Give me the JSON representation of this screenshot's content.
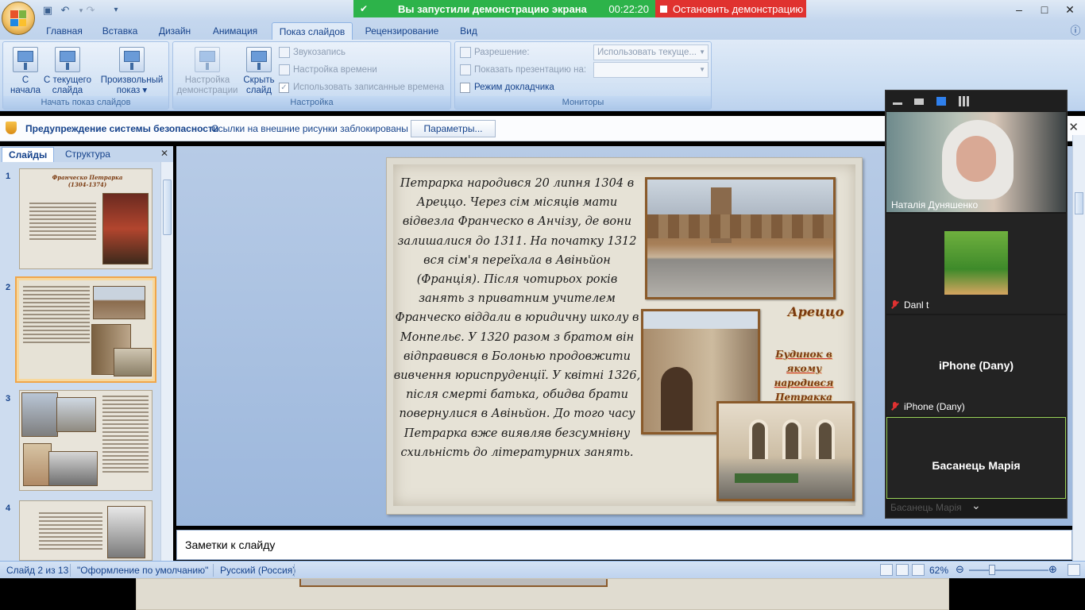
{
  "app": {
    "qat": [
      "save-icon",
      "undo-icon",
      "redo-icon",
      "qat-more-icon"
    ],
    "window_controls": [
      "–",
      "□",
      "✕"
    ]
  },
  "share_banner": {
    "message": "Вы запустили демонстрацию экрана",
    "timer": "00:22:20",
    "stop_label": "Остановить демонстрацию",
    "green": "#2db34a",
    "red": "#e0322f"
  },
  "tabs": [
    {
      "label": "Главная"
    },
    {
      "label": "Вставка"
    },
    {
      "label": "Дизайн"
    },
    {
      "label": "Анимация"
    },
    {
      "label": "Показ слайдов",
      "active": true
    },
    {
      "label": "Рецензирование"
    },
    {
      "label": "Вид"
    }
  ],
  "ribbon": {
    "start_group": {
      "label": "Начать показ слайдов",
      "from_start_l1": "С",
      "from_start_l2": "начала",
      "from_current_l1": "С текущего",
      "from_current_l2": "слайда",
      "custom_l1": "Произвольный",
      "custom_l2": "показ ▾"
    },
    "setup_group": {
      "label": "Настройка",
      "setup_show_l1": "Настройка",
      "setup_show_l2": "демонстрации",
      "hide_slide_l1": "Скрыть",
      "hide_slide_l2": "слайд",
      "record_narration": "Звукозапись",
      "rehearse_timings": "Настройка времени",
      "use_timings": "Использовать записанные времена"
    },
    "monitors_group": {
      "label": "Мониторы",
      "resolution_label": "Разрешение:",
      "resolution_value": "Использовать текуще...",
      "show_on_label": "Показать презентацию на:",
      "show_on_value": "",
      "presenter_view": "Режим докладчика"
    }
  },
  "security_bar": {
    "title": "Предупреждение системы безопасности",
    "message": "Ссылки на внешние рисунки заблокированы",
    "button": "Параметры..."
  },
  "slides_pane": {
    "tab_slides": "Слайды",
    "tab_outline": "Структура",
    "thumbs": [
      {
        "num": "1",
        "title": "Франческо Петрарка (1304-1374)"
      },
      {
        "num": "2",
        "title": "",
        "selected": true
      },
      {
        "num": "3",
        "title": ""
      },
      {
        "num": "4",
        "title": ""
      }
    ]
  },
  "slide": {
    "body": "Петрарка народився 20 липня 1304 в Ареццо. Через сім місяців мати відвезла Франческо в Анчізу, де вони залишалися до 1311. На початку 1312 вся сім'я переїхала в Авіньйон (Франція). Після чотирьох років занять з приватним учителем Франческо віддали в юридичну школу в Монпельє. У 1320 разом з братом він відправився в Болонью продовжити вивчення юриспруденції. У квітні 1326, після смерті батька, обидва брати повернулися в Авіньйон. До того часу Петрарка вже виявляв безсумнівну схильність до літературних занять.",
    "caption_arezzo": "Ареццо",
    "caption_house": "Будинок в якому народився Петракка"
  },
  "notes": {
    "placeholder": "Заметки к слайду"
  },
  "status_bar": {
    "slide_count": "Слайд 2 из 13",
    "theme": "\"Оформление по умолчанию\"",
    "language": "Русский (Россия)",
    "zoom": "62%"
  },
  "video_panel": {
    "participants": [
      {
        "name": "Наталія Дуняшенко",
        "video": true
      },
      {
        "name": "Danl t",
        "video": true,
        "muted": true
      },
      {
        "name": "iPhone (Dany)",
        "big_name": "iPhone (Dany)",
        "muted": true
      },
      {
        "name": "Басанець Марія",
        "big_name": "Басанець Марія",
        "active_speaker": true
      }
    ]
  }
}
